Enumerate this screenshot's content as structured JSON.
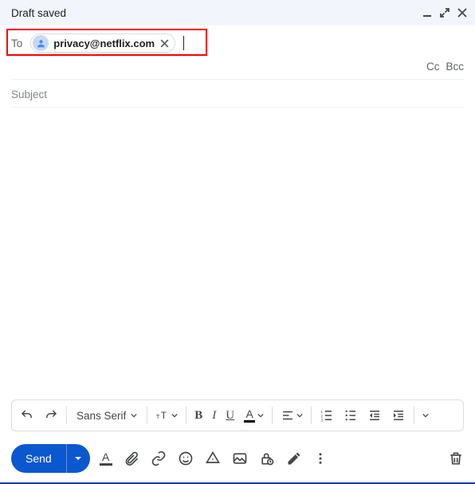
{
  "colors": {
    "accent": "#0b57d0"
  },
  "header": {
    "title": "Draft saved"
  },
  "to": {
    "label": "To",
    "chip_email": "privacy@netflix.com",
    "cc_label": "Cc",
    "bcc_label": "Bcc"
  },
  "subject": {
    "placeholder": "Subject",
    "value": ""
  },
  "format": {
    "font_name": "Sans Serif",
    "bold": "B",
    "italic": "I",
    "underline": "U",
    "color": "A"
  },
  "send": {
    "label": "Send"
  },
  "icons": {
    "minimize": "minimize-icon",
    "expand": "expand-icon",
    "close": "close-icon",
    "avatar": "person-icon",
    "chip_remove": "x-icon",
    "undo": "undo-icon",
    "redo": "redo-icon",
    "text_size": "text-size-icon",
    "align": "align-icon",
    "list_num": "list-numbered-icon",
    "list_bul": "list-bulleted-icon",
    "indent_dec": "indent-decrease-icon",
    "indent_inc": "indent-increase-icon",
    "quote": "quote-icon",
    "strike": "strikethrough-icon",
    "more_format": "more-format-icon",
    "format_toggle": "format-color-icon",
    "attach": "attach-icon",
    "link": "link-icon",
    "emoji": "emoji-icon",
    "drive": "drive-icon",
    "photo": "photo-icon",
    "confidential": "lock-clock-icon",
    "signature": "pen-icon",
    "more": "more-vert-icon",
    "trash": "trash-icon"
  }
}
